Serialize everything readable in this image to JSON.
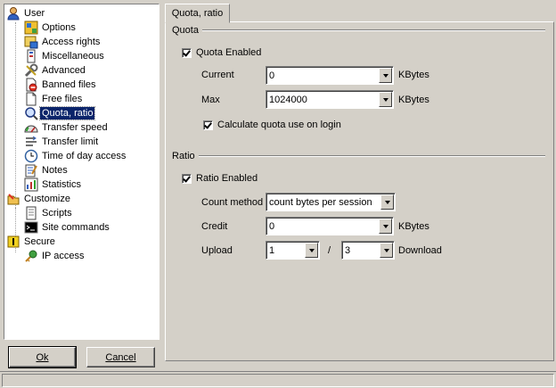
{
  "tree": {
    "groups": [
      {
        "label": "User",
        "icon": "user-icon"
      },
      {
        "label": "Customize",
        "icon": "customize-icon"
      },
      {
        "label": "Secure",
        "icon": "secure-icon"
      }
    ],
    "items": [
      {
        "label": "Options",
        "icon": "options-icon"
      },
      {
        "label": "Access rights",
        "icon": "access-rights-icon"
      },
      {
        "label": "Miscellaneous",
        "icon": "miscellaneous-icon"
      },
      {
        "label": "Advanced",
        "icon": "advanced-icon"
      },
      {
        "label": "Banned files",
        "icon": "banned-files-icon"
      },
      {
        "label": "Free files",
        "icon": "free-files-icon"
      },
      {
        "label": "Quota, ratio",
        "icon": "quota-ratio-icon"
      },
      {
        "label": "Transfer speed",
        "icon": "transfer-speed-icon"
      },
      {
        "label": "Transfer limit",
        "icon": "transfer-limit-icon"
      },
      {
        "label": "Time of day access",
        "icon": "clock-icon"
      },
      {
        "label": "Notes",
        "icon": "notes-icon"
      },
      {
        "label": "Statistics",
        "icon": "statistics-icon"
      },
      {
        "label": "Scripts",
        "icon": "scripts-icon"
      },
      {
        "label": "Site commands",
        "icon": "site-commands-icon"
      },
      {
        "label": "IP access",
        "icon": "ip-access-icon"
      }
    ],
    "selected": "Quota, ratio"
  },
  "buttons": {
    "ok": "Ok",
    "cancel": "Cancel"
  },
  "tab": {
    "label": "Quota, ratio"
  },
  "quota": {
    "group_label": "Quota",
    "enabled_label": "Quota Enabled",
    "enabled": true,
    "current_label": "Current",
    "current_value": "0",
    "current_unit": "KBytes",
    "max_label": "Max",
    "max_value": "1024000",
    "max_unit": "KBytes",
    "calc_label": "Calculate quota use on login",
    "calc_checked": true
  },
  "ratio": {
    "group_label": "Ratio",
    "enabled_label": "Ratio Enabled",
    "enabled": true,
    "count_method_label": "Count method",
    "count_method_value": "count bytes per session",
    "credit_label": "Credit",
    "credit_value": "0",
    "credit_unit": "KBytes",
    "upload_label": "Upload",
    "upload_value": "1",
    "separator": "/",
    "download_value": "3",
    "download_label": "Download"
  },
  "colors": {
    "selection": "#0a246a",
    "face": "#d4d0c8"
  }
}
